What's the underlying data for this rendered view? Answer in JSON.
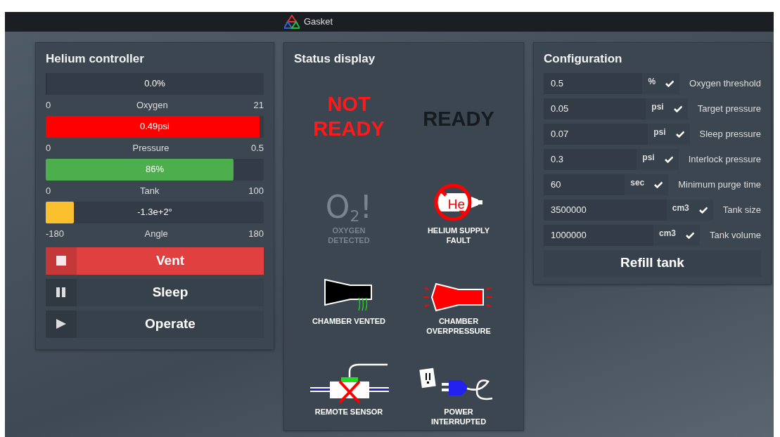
{
  "app_bar": {
    "title": "Gasket"
  },
  "controller": {
    "title": "Helium controller",
    "meters": [
      {
        "reading": "0.0%",
        "label": "Oxygen",
        "min": "0",
        "max": "21",
        "level": 0
      },
      {
        "reading": "0.49psi",
        "label": "Pressure",
        "min": "0",
        "max": "0.5",
        "level": 0.98,
        "color": "#ff0000"
      },
      {
        "reading": "86%",
        "label": "Tank",
        "min": "0",
        "max": "100",
        "level": 0.86,
        "color": "#4cae4c"
      },
      {
        "reading": "-1.3e+2°",
        "label": "Angle",
        "min": "-180",
        "max": "180",
        "level": 0.13,
        "color": "#fbc02d"
      }
    ],
    "modes": [
      {
        "label": "Vent",
        "kind": "stop",
        "selected": true
      },
      {
        "label": "Sleep",
        "kind": "pause",
        "selected": false
      },
      {
        "label": "Operate",
        "kind": "play",
        "selected": false
      }
    ]
  },
  "status": {
    "title": "Status display",
    "indicators": [
      {
        "kind": "not-ready",
        "label": "NOT READY",
        "active": true
      },
      {
        "kind": "ready",
        "label": "READY",
        "active": false
      },
      {
        "kind": "oxygen",
        "symbol": "O$_{2}$!",
        "label": "OXYGEN DETECTED",
        "active": false
      },
      {
        "kind": "helium",
        "symbol": "He",
        "label": "HELIUM SUPPLY FAULT",
        "active": true
      },
      {
        "kind": "vented",
        "label": "CHAMBER VENTED",
        "active": true
      },
      {
        "kind": "overpressure",
        "label": "CHAMBER OVERPRESSURE",
        "active": true
      },
      {
        "kind": "sensor",
        "label": "REMOTE SENSOR",
        "active": true
      },
      {
        "kind": "power",
        "label": "POWER INTERRUPTED",
        "active": true
      }
    ]
  },
  "configuration": {
    "title": "Configuration",
    "settings": [
      {
        "value": "0.5",
        "unit": "%",
        "label": "Oxygen threshold"
      },
      {
        "value": "0.05",
        "unit": "psi",
        "label": "Target pressure"
      },
      {
        "value": "0.07",
        "unit": "psi",
        "label": "Sleep pressure"
      },
      {
        "value": "0.3",
        "unit": "psi",
        "label": "Interlock pressure"
      },
      {
        "value": "60",
        "unit": "sec",
        "label": "Minimum purge time"
      },
      {
        "value": "3500000",
        "unit": "cm3",
        "label": "Tank size"
      },
      {
        "value": "1000000",
        "unit": "cm3",
        "label": "Tank volume"
      }
    ],
    "refill_button": "Refill tank"
  }
}
